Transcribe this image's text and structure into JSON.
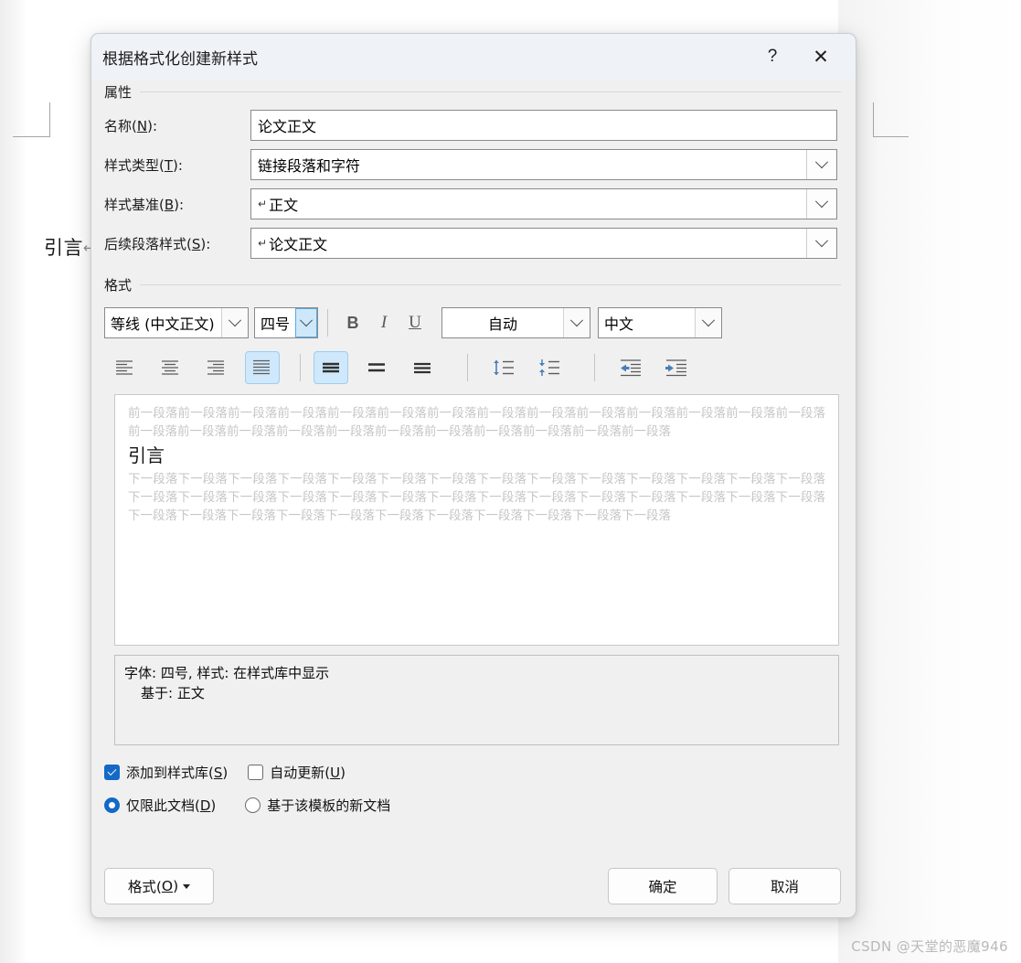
{
  "document_background": {
    "heading": "引言",
    "pilcrow": "↵"
  },
  "watermark": "CSDN @天堂的恶魔946",
  "dialog": {
    "title": "根据格式化创建新样式",
    "help_icon": "?",
    "close_icon": "✕",
    "sections": {
      "properties_label": "属性",
      "format_label": "格式"
    },
    "properties": [
      {
        "label_prefix": "名称(",
        "label_key": "N",
        "label_suffix": "):",
        "value": "论文正文",
        "type": "textbox",
        "prefix_mark": ""
      },
      {
        "label_prefix": "样式类型(",
        "label_key": "T",
        "label_suffix": "):",
        "value": "链接段落和字符",
        "type": "combobox",
        "prefix_mark": ""
      },
      {
        "label_prefix": "样式基准(",
        "label_key": "B",
        "label_suffix": "):",
        "value": "正文",
        "type": "combobox",
        "prefix_mark": "↵"
      },
      {
        "label_prefix": "后续段落样式(",
        "label_key": "S",
        "label_suffix": "):",
        "value": "论文正文",
        "type": "combobox",
        "prefix_mark": "↵"
      }
    ],
    "format_toolbar": {
      "font_name": "等线 (中文正文)",
      "font_size": "四号",
      "bold_label": "B",
      "italic_label": "I",
      "underline_label": "U",
      "color": "自动",
      "language": "中文",
      "font_size_focused": true
    },
    "alignment": {
      "align_left": "align-left",
      "align_center": "align-center",
      "align_right": "align-right",
      "align_justify": "align-justify",
      "selected_alignment": "align-justify",
      "spacing_single": "line-spacing-single",
      "spacing_1_5": "line-spacing-1.5",
      "spacing_double": "line-spacing-double",
      "selected_spacing": "line-spacing-single",
      "space_before": "increase-paragraph-spacing",
      "space_after": "decrease-paragraph-spacing",
      "decrease_indent": "decrease-indent",
      "increase_indent": "increase-indent"
    },
    "preview": {
      "before_text": "前一段落前一段落前一段落前一段落前一段落前一段落前一段落前一段落前一段落前一段落前一段落前一段落前一段落前一段落前一段落前一段落前一段落前一段落前一段落前一段落前一段落前一段落前一段落前一段落前一段落",
      "heading": "引言",
      "after_text": "下一段落下一段落下一段落下一段落下一段落下一段落下一段落下一段落下一段落下一段落下一段落下一段落下一段落下一段落下一段落下一段落下一段落下一段落下一段落下一段落下一段落下一段落下一段落下一段落下一段落下一段落下一段落下一段落下一段落下一段落下一段落下一段落下一段落下一段落下一段落下一段落下一段落下一段落下一段落"
    },
    "description": {
      "line1": "字体: 四号, 样式: 在样式库中显示",
      "line2": "基于: 正文"
    },
    "options": {
      "add_to_gallery": {
        "label_prefix": "添加到样式库(",
        "label_key": "S",
        "label_suffix": ")",
        "checked": true
      },
      "auto_update": {
        "label_prefix": "自动更新(",
        "label_key": "U",
        "label_suffix": ")",
        "checked": false
      },
      "this_doc_only": {
        "label_prefix": "仅限此文档(",
        "label_key": "D",
        "label_suffix": ")",
        "checked": true
      },
      "new_docs_from_template": {
        "label_prefix": "基于该模板的新文档",
        "label_key": "",
        "label_suffix": "",
        "checked": false
      }
    },
    "footer": {
      "format_prefix": "格式(",
      "format_key": "O",
      "format_suffix": ")",
      "ok": "确定",
      "cancel": "取消"
    }
  },
  "colors": {
    "accent_blue": "#1469c7",
    "selected_bg": "#cfe8fb",
    "titlebar_bg": "#eff3f7",
    "dialog_bg": "#f0f0f0",
    "icon_blue": "#4a7fb5"
  }
}
